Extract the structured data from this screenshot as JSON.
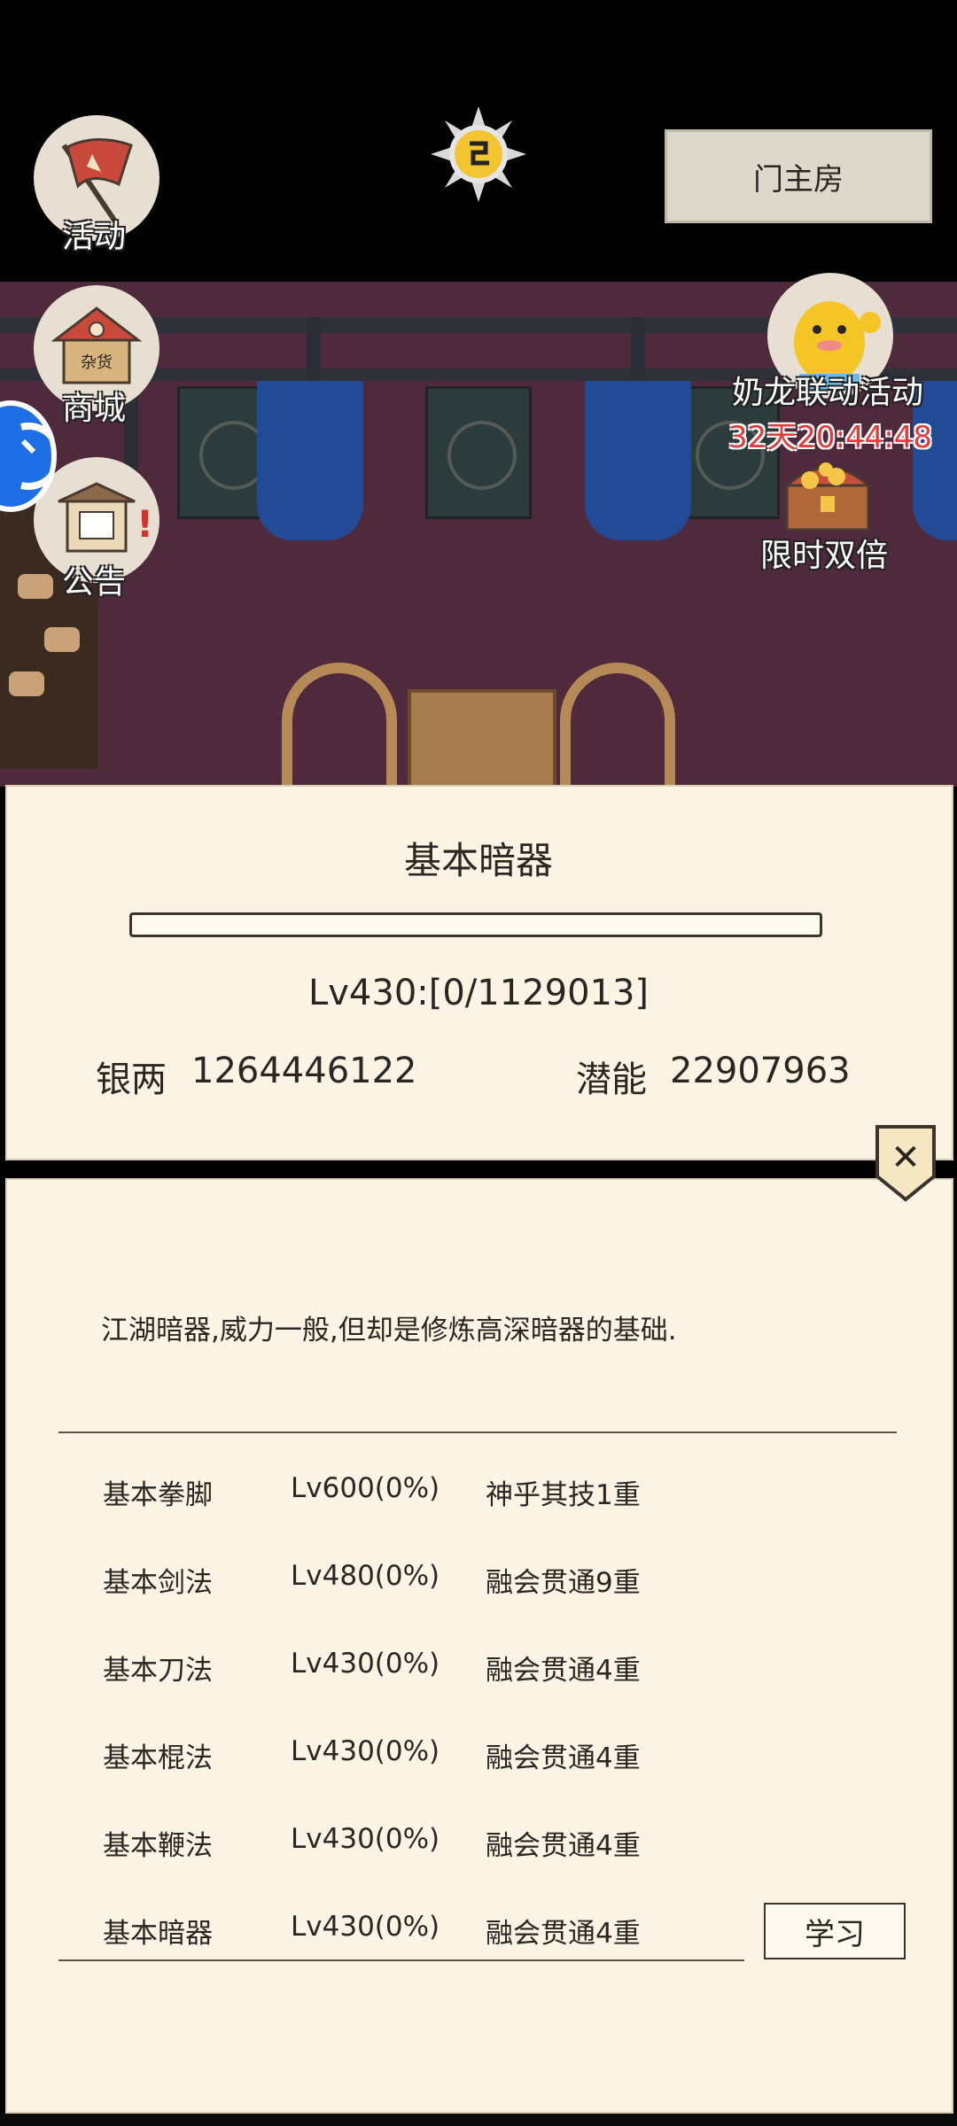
{
  "header": {
    "room_button_label": "门主房"
  },
  "left_menu": {
    "activity_label": "活动",
    "shop_label": "商城",
    "shop_sign_text": "杂货",
    "notice_label": "公告"
  },
  "right_menu": {
    "collab_label": "奶龙联动活动",
    "collab_timer": "32天20:44:48",
    "double_label": "限时双倍"
  },
  "skill_panel": {
    "title": "基本暗器",
    "progress": 0,
    "level_text": "Lv430:[0/1129013]",
    "silver_label": "银两",
    "silver_value": "1264446122",
    "potential_label": "潜能",
    "potential_value": "22907963"
  },
  "detail_panel": {
    "description": "江湖暗器,威力一般,但却是修炼高深暗器的基础.",
    "skills": [
      {
        "name": "基本拳脚",
        "level": "Lv600(0%)",
        "rank": "神乎其技1重"
      },
      {
        "name": "基本剑法",
        "level": "Lv480(0%)",
        "rank": "融会贯通9重"
      },
      {
        "name": "基本刀法",
        "level": "Lv430(0%)",
        "rank": "融会贯通4重"
      },
      {
        "name": "基本棍法",
        "level": "Lv430(0%)",
        "rank": "融会贯通4重"
      },
      {
        "name": "基本鞭法",
        "level": "Lv430(0%)",
        "rank": "融会贯通4重"
      },
      {
        "name": "基本暗器",
        "level": "Lv430(0%)",
        "rank": "融会贯通4重"
      }
    ],
    "learn_button_label": "学习",
    "close_symbol": "✕"
  },
  "colors": {
    "panel_bg": "#fbf4e4",
    "scene_wall": "#4f2a3d",
    "drape_blue": "#234a96",
    "timer_red": "#e43b3b"
  }
}
